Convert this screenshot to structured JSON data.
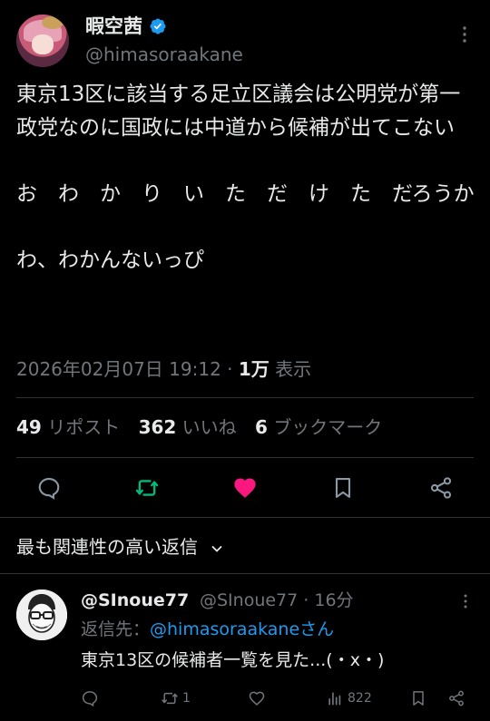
{
  "author": {
    "display_name": "暇空茜",
    "handle": "@himasoraakane",
    "verified": true
  },
  "tweet": {
    "text": "東京13区に該当する足立区議会は公明党が第一政党なのに国政には中道から候補が出てこない\n\nお　わ　か　り　い　た　だ　け　た　だろうか\n\nわ、わかんないっぴ",
    "datetime": "2026年02月07日 19:12",
    "separator": "·",
    "views_count": "1万",
    "views_label": "表示"
  },
  "stats": {
    "reposts_count": "49",
    "reposts_label": "リポスト",
    "likes_count": "362",
    "likes_label": "いいね",
    "bookmarks_count": "6",
    "bookmarks_label": "ブックマーク"
  },
  "actions": {
    "icons": [
      "reply-icon",
      "repost-icon",
      "like-icon",
      "bookmark-icon",
      "share-icon"
    ],
    "repost_color": "#00ba7c",
    "like_color": "#f91880"
  },
  "replies_sort": {
    "label": "最も関連性の高い返信"
  },
  "reply": {
    "display_name": "@SInoue77",
    "handle_time": "@SInoue77 · 16分",
    "reply_to_prefix": "返信先：",
    "reply_to_mention": "@himasoraakaneさん",
    "text": "東京13区の候補者一覧を見た...(・x・)",
    "repost_count": "1",
    "views_count": "822"
  },
  "colors": {
    "background": "#000000",
    "text": "#e7e9ea",
    "muted": "#71767b",
    "accent": "#1d9bf0",
    "divider": "#2f3336"
  }
}
